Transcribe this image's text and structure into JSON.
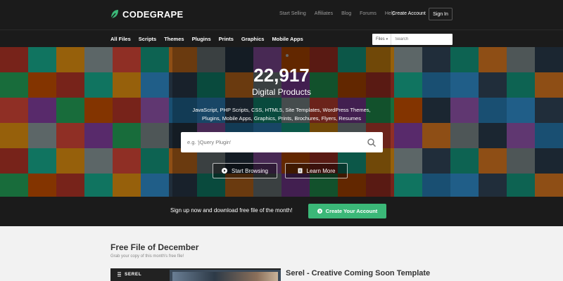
{
  "header": {
    "logo_text": "CODEGRAPE",
    "links": [
      "Start Selling",
      "Affiliates",
      "Blog",
      "Forums",
      "Help"
    ],
    "create_account": "Create Account",
    "sign_in": "Sign In"
  },
  "nav": {
    "categories": [
      "All Files",
      "Scripts",
      "Themes",
      "Plugins",
      "Prints",
      "Graphics",
      "Mobile Apps"
    ],
    "search_scope": "Files",
    "search_placeholder": "Search"
  },
  "hero": {
    "count": "22,917",
    "count_label": "Digital Products",
    "tags": "JavaScript, PHP Scripts, CSS, HTML5, Site Templates, WordPress Themes, Plugins, Mobile Apps, Graphics, Prints, Brochures, Flyers, Resumes",
    "search_placeholder": "e.g. 'jQuery Plugin'",
    "browse_label": "Start Browsing",
    "learn_label": "Learn More"
  },
  "signup": {
    "text": "Sign up now and download free file of the month!",
    "button": "Create Your Account"
  },
  "free_file": {
    "title": "Free File of December",
    "subtitle": "Grab your copy of this month's free file!",
    "thumb_logo": "SEREL",
    "item_title": "Serel - Creative Coming Soon Template"
  },
  "colors": {
    "dark": "#1b1b1b",
    "accent_green": "#3bb878",
    "logo_green": "#3bb878"
  }
}
